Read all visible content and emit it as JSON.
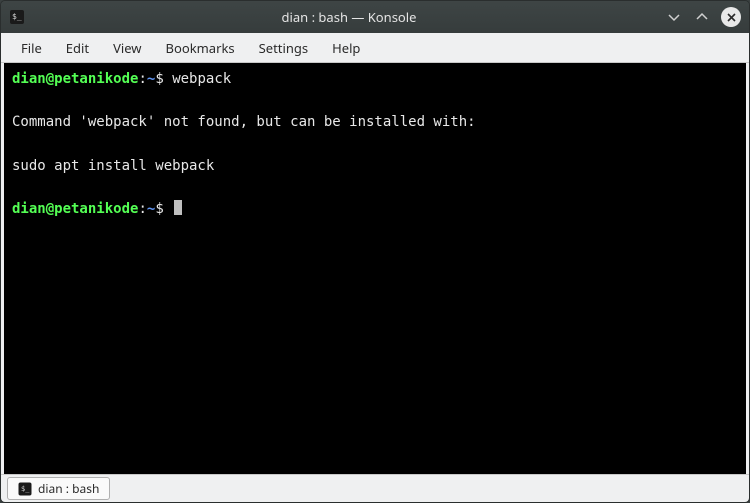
{
  "window": {
    "title": "dian : bash — Konsole"
  },
  "menubar": {
    "items": [
      "File",
      "Edit",
      "View",
      "Bookmarks",
      "Settings",
      "Help"
    ]
  },
  "prompt": {
    "user_host": "dian@petanikode",
    "separator": ":",
    "path": "~",
    "symbol": "$"
  },
  "session": {
    "command1": "webpack",
    "output_line1": "Command 'webpack' not found, but can be installed with:",
    "output_line2": "sudo apt install webpack"
  },
  "tab": {
    "label": "dian : bash"
  }
}
